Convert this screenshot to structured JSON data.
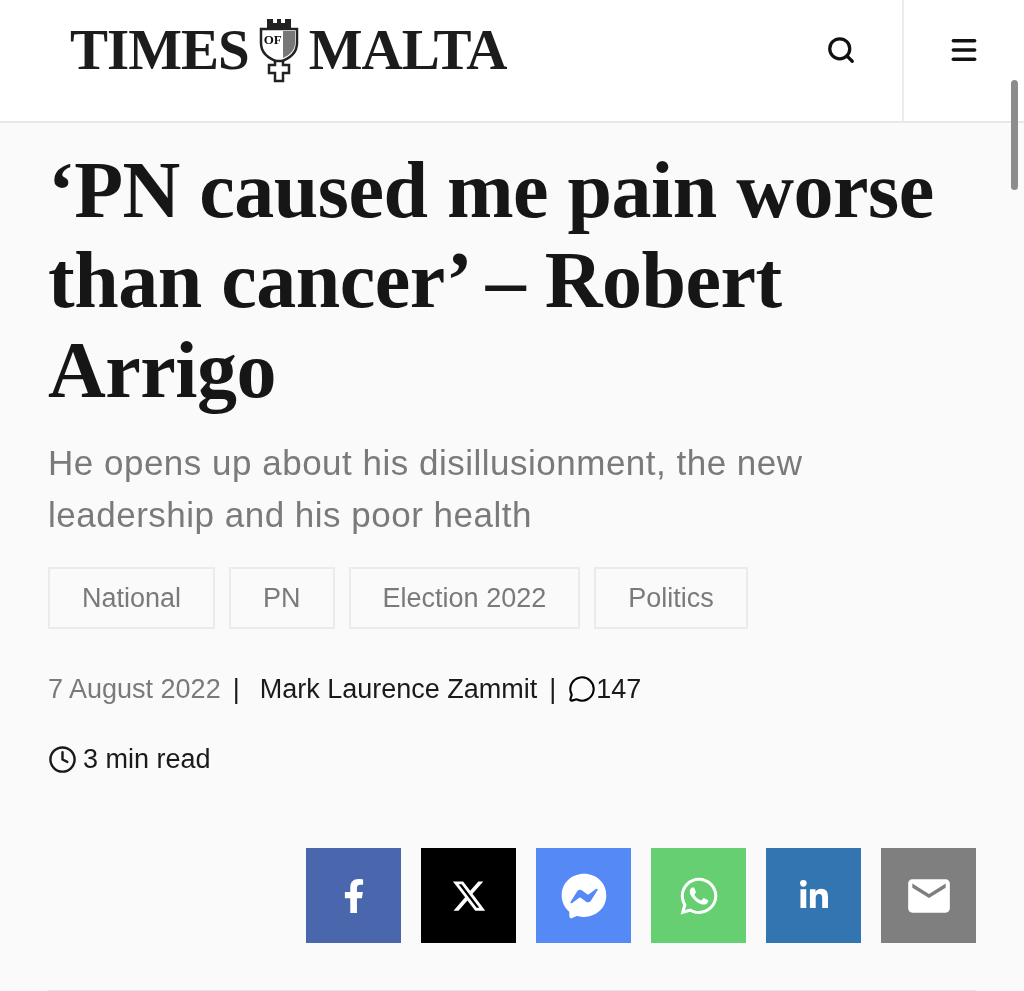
{
  "header": {
    "logo": {
      "left": "TIMES",
      "crest": "OF",
      "right": "MALTA"
    }
  },
  "article": {
    "headline": "‘PN caused me pain worse than cancer’ – Robert Arrigo",
    "standfirst": "He opens up about his disillusionment, the new leadership and his poor health",
    "tags": [
      "National",
      "PN",
      "Election 2022",
      "Politics"
    ],
    "meta": [
      {
        "kind": "date",
        "text": "7 August 2022"
      },
      {
        "kind": "separator",
        "text": "|"
      },
      {
        "kind": "author",
        "text": "Mark Laurence Zammit"
      },
      {
        "kind": "separator",
        "text": "|"
      },
      {
        "kind": "comments",
        "text": "147"
      }
    ],
    "read_time": "3 min read",
    "share_buttons": [
      {
        "kind": "facebook",
        "color": "#4a66ad"
      },
      {
        "kind": "x",
        "color": "#000000"
      },
      {
        "kind": "messenger",
        "color": "#5589f5"
      },
      {
        "kind": "whatsapp",
        "color": "#65cf72"
      },
      {
        "kind": "linkedin",
        "color": "#3275b0"
      },
      {
        "kind": "email",
        "color": "#7f7f7f"
      }
    ]
  }
}
